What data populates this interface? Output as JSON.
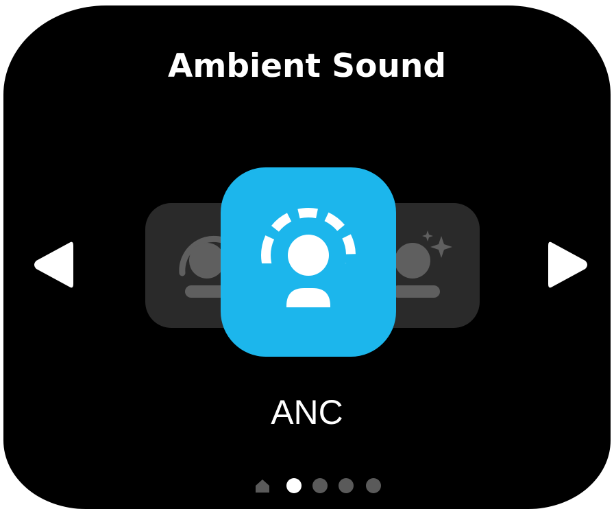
{
  "screen": {
    "title": "Ambient Sound",
    "current_mode": "ANC"
  },
  "navigation": {
    "prev_icon": "chevron-left-triangle",
    "next_icon": "chevron-right-triangle"
  },
  "modes": [
    {
      "name": "awareness",
      "icon": "person-ear-arc-icon",
      "position": "left"
    },
    {
      "name": "ANC",
      "icon": "person-dashed-dome-icon",
      "position": "center"
    },
    {
      "name": "adaptive",
      "icon": "person-sparkle-icon",
      "position": "right"
    }
  ],
  "pager": {
    "home_icon": "home-icon",
    "count": 5,
    "active_index": 1
  },
  "colors": {
    "background": "#000000",
    "accent": "#1cb6ec",
    "side_card": "#2a2a2a",
    "icon_dim": "#5f5f5f",
    "dot_inactive": "#5a5a5a",
    "text": "#ffffff"
  }
}
